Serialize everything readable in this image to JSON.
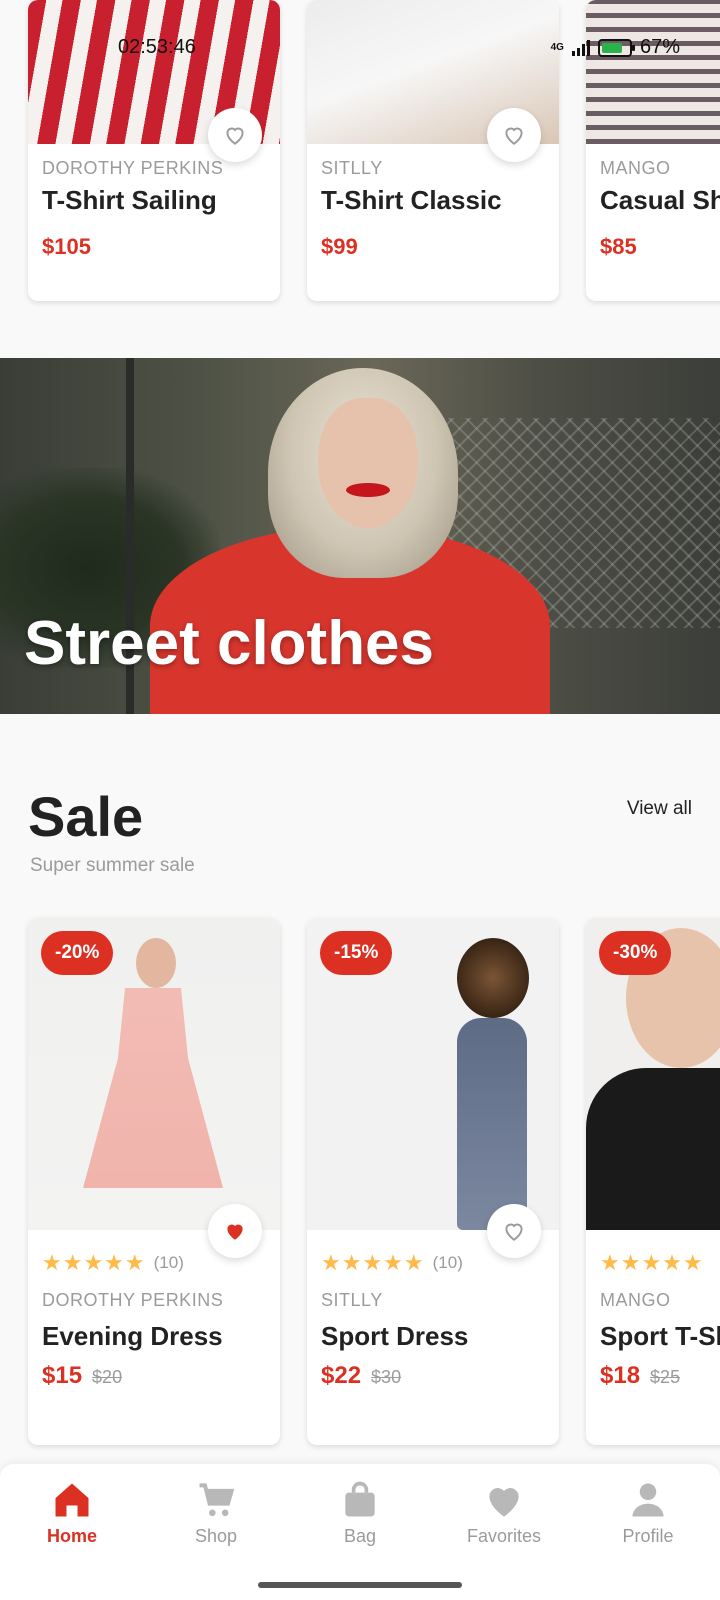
{
  "status_bar": {
    "time": "02:53:46",
    "network": "4G",
    "battery": "67%"
  },
  "top_products": [
    {
      "brand": "DOROTHY PERKINS",
      "name": "T-Shirt Sailing",
      "price": "$105"
    },
    {
      "brand": "SITLLY",
      "name": "T-Shirt Classic",
      "price": "$99"
    },
    {
      "brand": "MANGO",
      "name": "Casual Sh",
      "price": "$85"
    }
  ],
  "banner": {
    "title": "Street clothes"
  },
  "sale_section": {
    "title": "Sale",
    "subtitle": "Super summer sale",
    "view_all": "View all"
  },
  "sale_products": [
    {
      "discount": "-20%",
      "rating": 5,
      "rating_count": "(10)",
      "brand": "DOROTHY PERKINS",
      "name": "Evening Dress",
      "price": "$15",
      "old_price": "$20",
      "favorited": true
    },
    {
      "discount": "-15%",
      "rating": 5,
      "rating_count": "(10)",
      "brand": "SITLLY",
      "name": "Sport Dress",
      "price": "$22",
      "old_price": "$30",
      "favorited": false
    },
    {
      "discount": "-30%",
      "rating": 5,
      "rating_count": "",
      "brand": "MANGO",
      "name": "Sport T-Sh",
      "price": "$18",
      "old_price": "$25",
      "favorited": false
    }
  ],
  "bottom_nav": {
    "items": [
      {
        "label": "Home",
        "icon": "home-icon",
        "active": true
      },
      {
        "label": "Shop",
        "icon": "cart-icon",
        "active": false
      },
      {
        "label": "Bag",
        "icon": "bag-icon",
        "active": false
      },
      {
        "label": "Favorites",
        "icon": "heart-icon",
        "active": false
      },
      {
        "label": "Profile",
        "icon": "profile-icon",
        "active": false
      }
    ]
  },
  "colors": {
    "accent": "#db3022",
    "star": "#ffba49",
    "muted": "#9b9b9b",
    "background": "#f9f9f9"
  }
}
